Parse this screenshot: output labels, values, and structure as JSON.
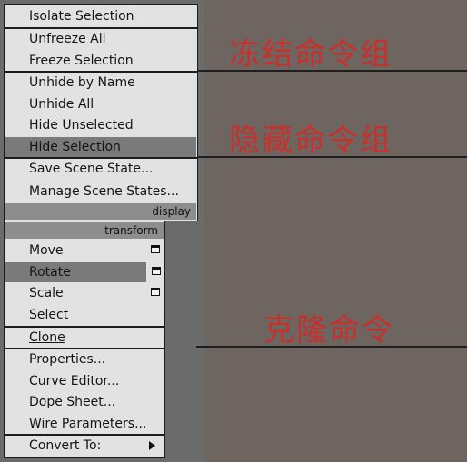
{
  "upper_menu": {
    "items": [
      "Isolate Selection",
      "Unfreeze All",
      "Freeze Selection",
      "Unhide by Name",
      "Unhide All",
      "Hide Unselected",
      "Hide Selection",
      "Save Scene State...",
      "Manage Scene States..."
    ],
    "header": "display"
  },
  "lower_menu": {
    "header": "transform",
    "items": [
      "Move",
      "Rotate",
      "Scale",
      "Select",
      "Clone",
      "Properties...",
      "Curve Editor...",
      "Dope Sheet...",
      "Wire Parameters...",
      "Convert To:"
    ],
    "dialog_icon_name": "dialog-box-icon",
    "submenu_icon_name": "submenu-arrow-icon"
  },
  "annotations": {
    "freeze_group": "冻结命令组",
    "hide_group": "隐藏命令组",
    "clone": "克隆命令"
  },
  "colors": {
    "annotation": "#c8302c",
    "menu_bg": "#e2e2e2",
    "highlight": "#7a7a7a",
    "header_bg": "#8d8d8d",
    "viewport_brown": "#6e6460",
    "viewport_gray": "#6b6b6b"
  }
}
